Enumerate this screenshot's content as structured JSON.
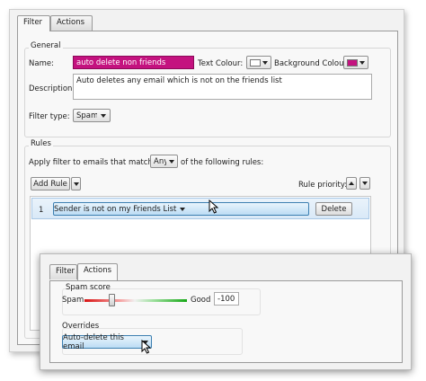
{
  "tabs": {
    "filter": "Filter",
    "actions": "Actions"
  },
  "general": {
    "title": "General",
    "name_label": "Name:",
    "name_value": "auto delete non friends",
    "text_colour_label": "Text Colour:",
    "background_colour_label": "Background Colour:",
    "background_colour": "#c4127f",
    "text_colour": "#ffffff",
    "description_label": "Description:",
    "description_value": "Auto deletes any email which is not on the friends list",
    "filter_type_label": "Filter type:",
    "filter_type_value": "Spam"
  },
  "rules": {
    "title": "Rules",
    "apply_prefix": "Apply filter to emails that match",
    "match_value": "Any",
    "apply_suffix": "of the following rules:",
    "add_rule_label": "Add Rule",
    "priority_label": "Rule priority:",
    "items": [
      {
        "index": "1",
        "condition": "Sender is not on my Friends List",
        "delete_label": "Delete"
      }
    ]
  },
  "actions_panel": {
    "spam_score_label": "Spam score",
    "spam_label": "Spam",
    "good_label": "Good",
    "score_value": "-100",
    "slider_fraction": 0.27,
    "overrides_label": "Overrides",
    "override_value": "Auto-delete this email"
  }
}
